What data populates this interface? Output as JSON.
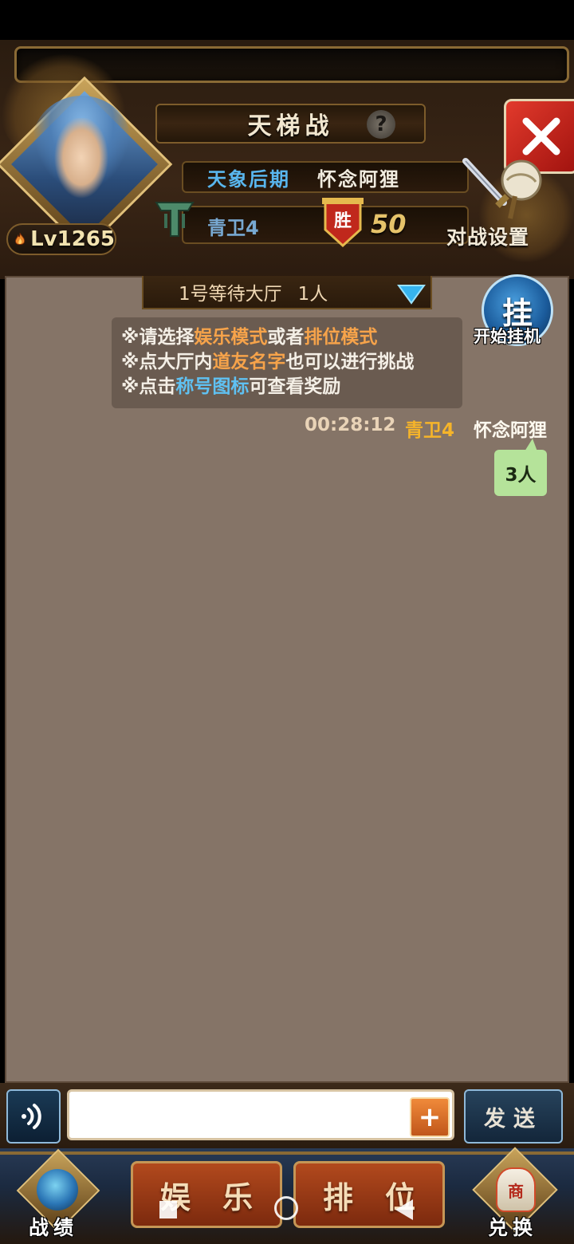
{
  "header": {
    "title": "天梯战",
    "help_icon": "help-icon",
    "close_icon": "close-icon"
  },
  "player": {
    "level": "Lv1265",
    "realm": "天象后期",
    "name": "怀念阿狸",
    "rank": "青卫4",
    "wins": "50",
    "win_badge_char": "胜"
  },
  "battle_settings": {
    "label": "对战设置"
  },
  "lobby": {
    "name": "1号等待大厅",
    "count": "1人"
  },
  "hangup": {
    "char": "挂",
    "label": "开始挂机"
  },
  "notice": {
    "line1": {
      "prefix": "※请选择",
      "mode1": "娱乐模式",
      "mid": "或者",
      "mode2": "排位模式"
    },
    "line2": {
      "prefix": "※点大厅内",
      "highlight": "道友名字",
      "suffix": "也可以进行挑战"
    },
    "line3": {
      "prefix": "※点击",
      "highlight": "称号图标",
      "suffix": "可查看奖励"
    }
  },
  "message": {
    "time": "00:28:12",
    "rank": "青卫4",
    "user": "怀念阿狸",
    "text": "3人"
  },
  "input": {
    "value": "",
    "placeholder": "",
    "plus": "+",
    "send_label": "发送"
  },
  "bottom_nav": {
    "record_label": "战绩",
    "entertain_chars": [
      "娱",
      "乐"
    ],
    "ranked_chars": [
      "排",
      "位"
    ],
    "exchange_label": "兑换",
    "exchange_bag_char": "商"
  },
  "colors": {
    "chat_bg": "#857467",
    "highlight_orange": "#f6a34a",
    "highlight_blue": "#5fc1f2",
    "rank_gold": "#f5b42a",
    "bubble_green": "#b5e39a"
  }
}
